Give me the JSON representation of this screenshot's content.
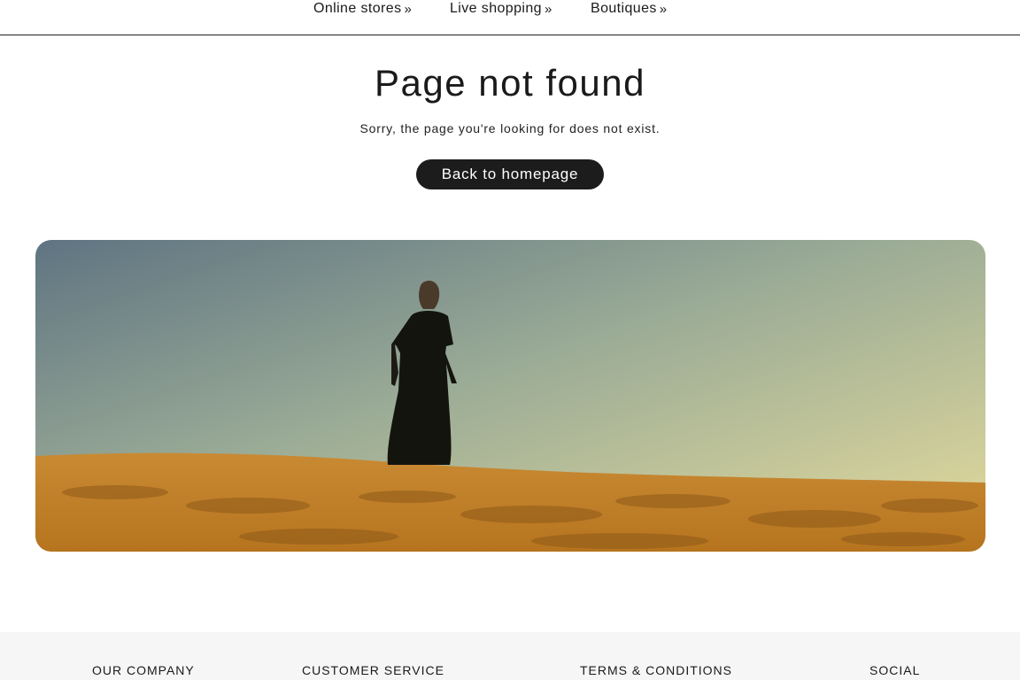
{
  "nav": {
    "items": [
      {
        "label": "Online stores",
        "chevron": "»"
      },
      {
        "label": "Live shopping",
        "chevron": "»"
      },
      {
        "label": "Boutiques",
        "chevron": "»"
      }
    ]
  },
  "main": {
    "title": "Page not found",
    "message": "Sorry, the page you're looking for does not exist.",
    "button_label": "Back to homepage"
  },
  "hero": {
    "icon": "desert-woman-photo"
  },
  "footer": {
    "columns": [
      {
        "label": "OUR COMPANY"
      },
      {
        "label": "CUSTOMER SERVICE"
      },
      {
        "label": "TERMS & CONDITIONS"
      },
      {
        "label": "SOCIAL"
      }
    ]
  },
  "colors": {
    "button_bg": "#1c1c1c",
    "footer_bg": "#f6f6f6",
    "sky_top": "#6b7f86",
    "sky_bottom": "#e2d79a",
    "sand": "#c8882e"
  }
}
